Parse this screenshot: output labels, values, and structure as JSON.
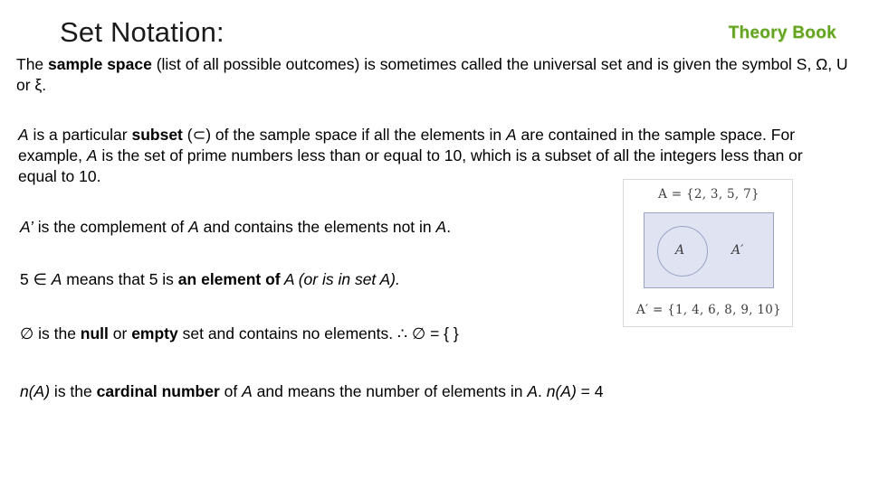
{
  "slide": {
    "title": "Set Notation:",
    "brand": "Theory Book",
    "paragraphs": {
      "p1_a": "The ",
      "p1_b": "sample space",
      "p1_c": " (list of all possible outcomes) is sometimes called the universal set and is given the symbol S, Ω, U or ξ.",
      "p2_a": "A",
      "p2_b": " is a particular ",
      "p2_c": "subset",
      "p2_d": " (⊂) of the sample space if all the elements in ",
      "p2_e": "A",
      "p2_f": " are contained in the sample space. For example, ",
      "p2_g": "A",
      "p2_h": " is the set of prime numbers less than or equal to 10, which is a subset of all the integers less than or equal to 10.",
      "p3_a": "A’",
      "p3_b": " is the complement of ",
      "p3_c": "A",
      "p3_d": " and contains the elements not in ",
      "p3_e": "A",
      "p3_f": ".",
      "p4_a": "5 ∈ ",
      "p4_b": "A",
      "p4_c": " means that 5 is ",
      "p4_d": "an element of",
      "p4_e": " A (or is in set A).",
      "p5_a": "∅ is the ",
      "p5_b": "null",
      "p5_c": " or ",
      "p5_d": "empty",
      "p5_e": " set and contains no elements.  ∴ ∅ = { }",
      "p6_a": "n(A)",
      "p6_b": " is the ",
      "p6_c": "cardinal number",
      "p6_d": " of ",
      "p6_e": "A",
      "p6_f": " and means the number of elements in ",
      "p6_g": "A",
      "p6_h": ". ",
      "p6_i": "n(A)",
      "p6_j": " = 4"
    },
    "figure": {
      "set_a_definition": "A = {2, 3, 5, 7}",
      "set_a_complement_definition": "A′ = {1, 4, 6, 8, 9, 10}",
      "circle_label": "A",
      "outside_label": "A′"
    }
  }
}
